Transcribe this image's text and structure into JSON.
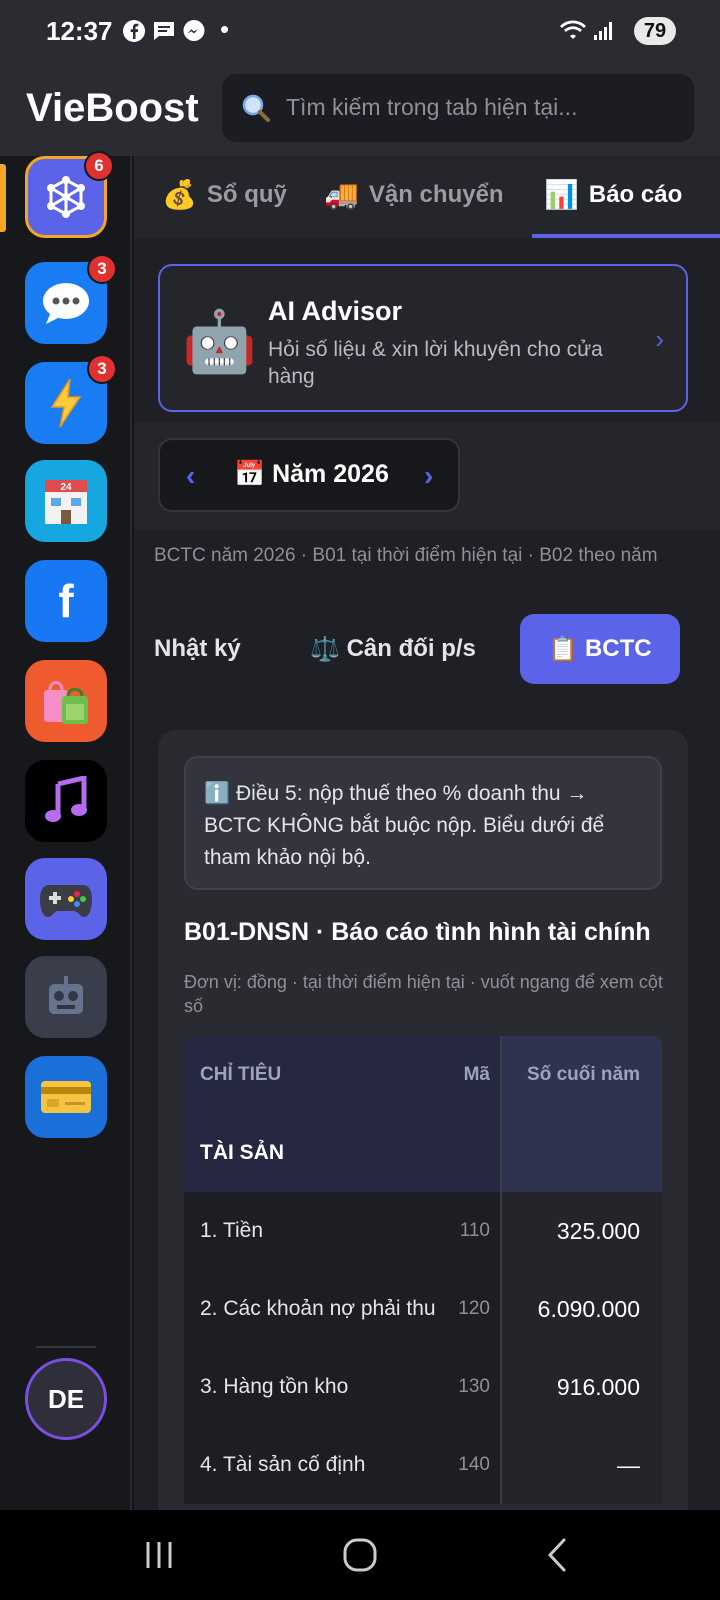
{
  "status_bar": {
    "time": "12:37",
    "battery": "79",
    "notif_dot": "•"
  },
  "header": {
    "brand": "VieBoost",
    "search_placeholder": "Tìm kiếm trong tab hiện tại..."
  },
  "sidebar": {
    "apps": [
      {
        "name": "hub",
        "icon": "network-icon",
        "badge": "6"
      },
      {
        "name": "messages",
        "icon": "chat-bubble-icon",
        "badge": "3"
      },
      {
        "name": "boost",
        "icon": "lightning-icon",
        "badge": "3"
      },
      {
        "name": "store",
        "icon": "convenience-store-icon"
      },
      {
        "name": "facebook",
        "icon": "facebook-icon",
        "glyph": "f"
      },
      {
        "name": "shopping",
        "icon": "shopping-bags-icon"
      },
      {
        "name": "music",
        "icon": "music-note-icon"
      },
      {
        "name": "games",
        "icon": "gamepad-icon"
      },
      {
        "name": "robot",
        "icon": "robot-icon"
      },
      {
        "name": "payments",
        "icon": "credit-card-icon"
      }
    ],
    "avatar": "DE"
  },
  "tabs": [
    {
      "label": "Sổ quỹ",
      "icon": "money-bag-icon"
    },
    {
      "label": "Vận chuyển",
      "icon": "truck-icon"
    },
    {
      "label": "Báo cáo",
      "icon": "bar-chart-icon",
      "active": true
    }
  ],
  "ai_advisor": {
    "title": "AI Advisor",
    "subtitle": "Hỏi số liệu & xin lời khuyên cho cửa hàng",
    "chevron": "›"
  },
  "year_picker": {
    "label": "Năm 2026",
    "prev": "‹",
    "next": "›"
  },
  "report_subtitle": "BCTC năm 2026 · B01 tại thời điểm hiện tại · B02 theo năm",
  "segments": {
    "journal": "Nhật ký",
    "balance": "Cân đối p/s",
    "bctc": "BCTC"
  },
  "notice": "Điều 5: nộp thuế theo % doanh thu → BCTC KHÔNG bắt buộc nộp. Biểu dưới để tham khảo nội bộ.",
  "report": {
    "title": "B01-DNSN · Báo cáo tình hình tài chính",
    "unit_note": "Đơn vị: đồng · tại thời điểm hiện tại · vuốt ngang để xem cột số",
    "columns": {
      "item": "CHỈ TIÊU",
      "code": "Mã",
      "value": "Số cuối năm"
    },
    "section": "TÀI SẢN",
    "rows": [
      {
        "name": "1. Tiền",
        "code": "110",
        "value": "325.000"
      },
      {
        "name": "2. Các khoản nợ phải thu",
        "code": "120",
        "value": "6.090.000"
      },
      {
        "name": "3. Hàng tồn kho",
        "code": "130",
        "value": "916.000"
      },
      {
        "name": "4. Tài sản cố định",
        "code": "140",
        "value": "—"
      }
    ]
  },
  "colors": {
    "accent": "#5b63e8",
    "badge": "#e03131",
    "indicator": "#f5a623"
  }
}
